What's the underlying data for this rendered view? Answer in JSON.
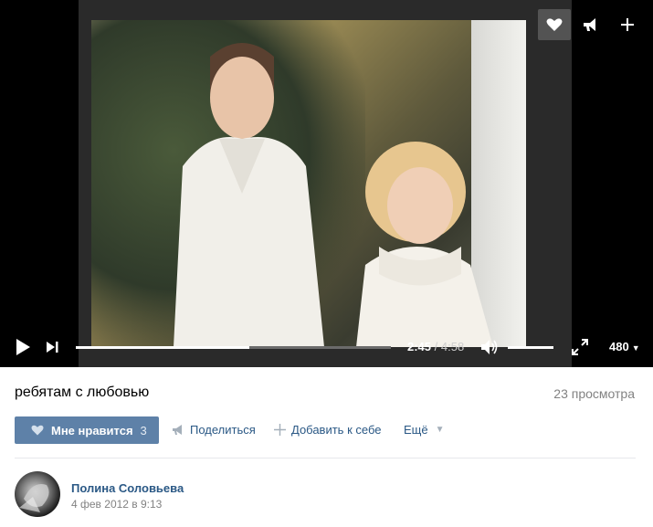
{
  "player": {
    "current_time": "2:45",
    "separator": " / ",
    "duration": "4:58",
    "progress": 0.55,
    "volume": 1.0,
    "quality": "480",
    "top_buttons": [
      "heart-icon",
      "share-icon",
      "plus-icon"
    ]
  },
  "video": {
    "title": "ребятам с любовью",
    "views": "23 просмотра"
  },
  "actions": {
    "like_label": "Мне нравится",
    "like_count": "3",
    "share_label": "Поделиться",
    "add_label": "Добавить к себе",
    "more_label": "Ещё"
  },
  "author": {
    "name": "Полина Соловьева",
    "date": "4 фев 2012 в 9:13"
  },
  "colors": {
    "accent": "#5e81a8",
    "link": "#2a5885",
    "muted": "#828282"
  }
}
